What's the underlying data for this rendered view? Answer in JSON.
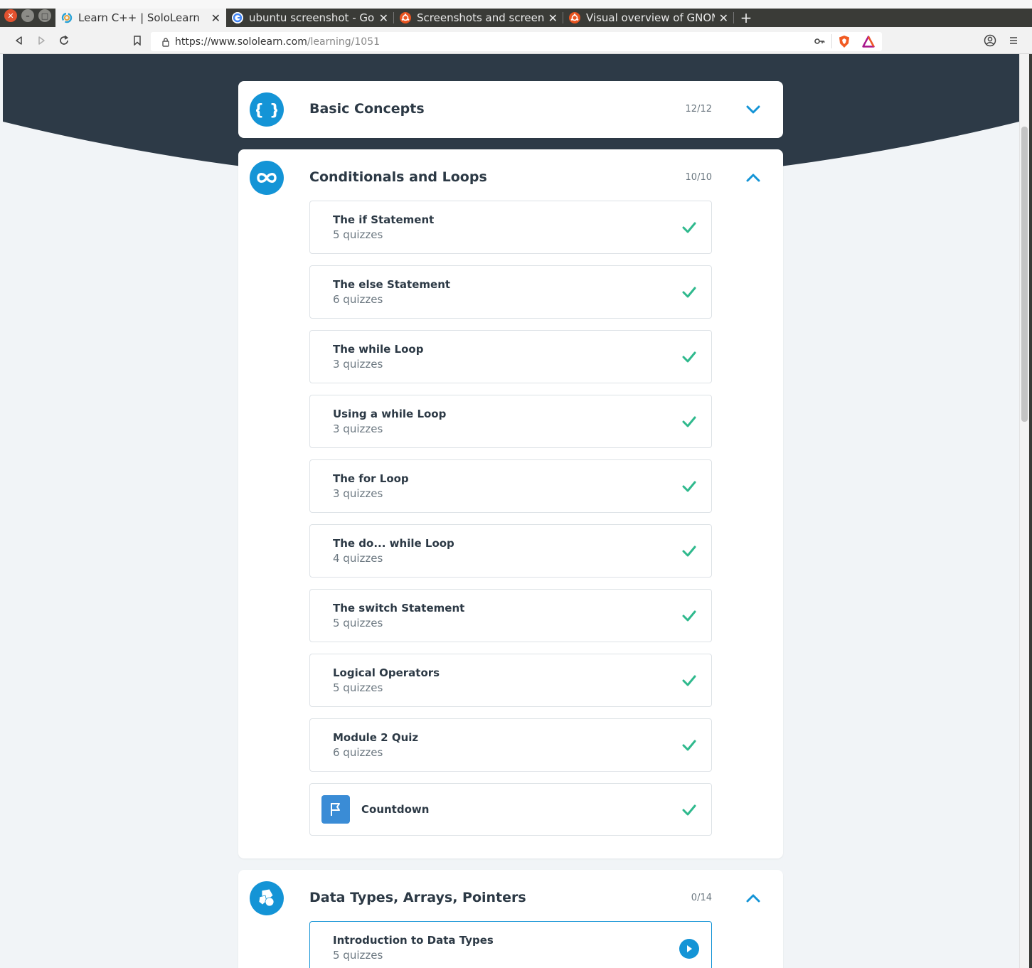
{
  "window": {
    "tabs": [
      {
        "title": "Learn C++ | SoloLearn",
        "active": true,
        "favicon": "sololearn-icon"
      },
      {
        "title": "ubuntu screenshot - Googl",
        "active": false,
        "favicon": "google-icon"
      },
      {
        "title": "Screenshots and screencas",
        "active": false,
        "favicon": "ubuntu-icon"
      },
      {
        "title": "Visual overview of GNOME",
        "active": false,
        "favicon": "ubuntu-icon"
      }
    ],
    "new_tab_label": "+"
  },
  "address_bar": {
    "url_host": "https://www.sololearn.com",
    "url_path": "/learning/1051"
  },
  "modules": [
    {
      "title": "Basic Concepts",
      "count": "12/12",
      "icon": "braces-icon",
      "expanded": false
    },
    {
      "title": "Conditionals and Loops",
      "count": "10/10",
      "icon": "infinity-icon",
      "expanded": true,
      "lessons": [
        {
          "title": "The if Statement",
          "subtitle": "5 quizzes",
          "status": "completed"
        },
        {
          "title": "The else Statement",
          "subtitle": "6 quizzes",
          "status": "completed"
        },
        {
          "title": "The while Loop",
          "subtitle": "3 quizzes",
          "status": "completed"
        },
        {
          "title": "Using a while Loop",
          "subtitle": "3 quizzes",
          "status": "completed"
        },
        {
          "title": "The for Loop",
          "subtitle": "3 quizzes",
          "status": "completed"
        },
        {
          "title": "The do... while Loop",
          "subtitle": "4 quizzes",
          "status": "completed"
        },
        {
          "title": "The switch Statement",
          "subtitle": "5 quizzes",
          "status": "completed"
        },
        {
          "title": "Logical Operators",
          "subtitle": "5 quizzes",
          "status": "completed"
        },
        {
          "title": "Module 2 Quiz",
          "subtitle": "6 quizzes",
          "status": "completed"
        }
      ],
      "project": {
        "title": "Countdown",
        "icon": "flag-icon",
        "status": "completed"
      }
    },
    {
      "title": "Data Types, Arrays, Pointers",
      "count": "0/14",
      "icon": "shapes-icon",
      "expanded": true,
      "lessons": [
        {
          "title": "Introduction to Data Types",
          "subtitle": "5 quizzes",
          "status": "current"
        }
      ]
    }
  ],
  "colors": {
    "accent": "#1494d6",
    "hero": "#2d3a47",
    "check": "#2fb98d",
    "background": "#f1f4f7"
  }
}
